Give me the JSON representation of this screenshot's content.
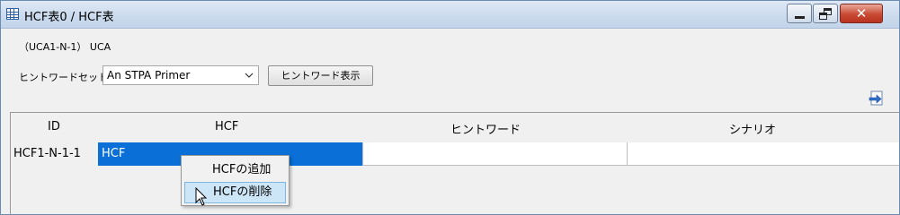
{
  "window": {
    "title": "HCF表0 / HCF表",
    "icon": "table-icon",
    "controls": {
      "minimize": "minimize-icon",
      "maximize": "restore-icon",
      "close": "✕"
    }
  },
  "uca_line": "（UCA1-N-1） UCA",
  "hint_set": {
    "label": "ヒントワードセット",
    "selected": "An STPA Primer",
    "show_button": "ヒントワード表示"
  },
  "export_icon": "export-icon",
  "table": {
    "headers": [
      "ID",
      "HCF",
      "ヒントワード",
      "シナリオ"
    ],
    "rows": [
      {
        "id": "HCF1-N-1-1",
        "hcf": "HCF",
        "hint": "",
        "scenario": ""
      }
    ]
  },
  "context_menu": {
    "items": [
      "HCFの追加",
      "HCFの削除"
    ],
    "highlighted_index": 1
  },
  "colors": {
    "selection": "#0a6fd6",
    "menu_highlight": "#cde6f7",
    "titlebar": "#cddcee"
  }
}
